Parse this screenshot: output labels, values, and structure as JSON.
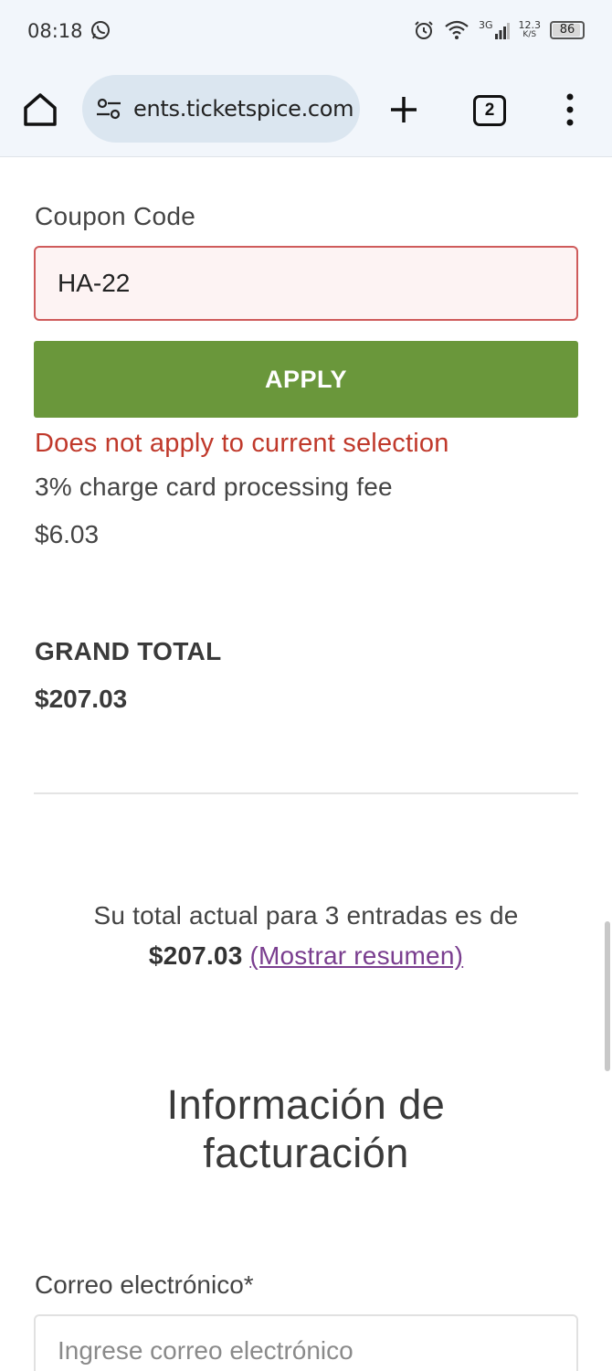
{
  "status_bar": {
    "time": "08:18",
    "network": "3G",
    "speed_value": "12.3",
    "speed_unit": "K/S",
    "battery": "86"
  },
  "browser": {
    "url": "ents.ticketspice.com",
    "tab_count": "2"
  },
  "coupon": {
    "label": "Coupon Code",
    "value": "HA-22",
    "apply_label": "APPLY",
    "error": "Does not apply to current selection"
  },
  "fee": {
    "label": "3% charge card processing fee",
    "amount": "$6.03"
  },
  "grand_total": {
    "label": "GRAND TOTAL",
    "amount": "$207.03"
  },
  "summary": {
    "text": "Su total actual para 3 entradas es de",
    "amount": "$207.03",
    "link": "(Mostrar resumen)"
  },
  "billing": {
    "title_line1": "Información de",
    "title_line2": "facturación",
    "email_label": "Correo electrónico",
    "required_mark": "*",
    "email_placeholder": "Ingrese correo electrónico"
  },
  "colors": {
    "apply_button": "#6a973b",
    "error_text": "#c0392b",
    "link": "#7a3e8f"
  }
}
